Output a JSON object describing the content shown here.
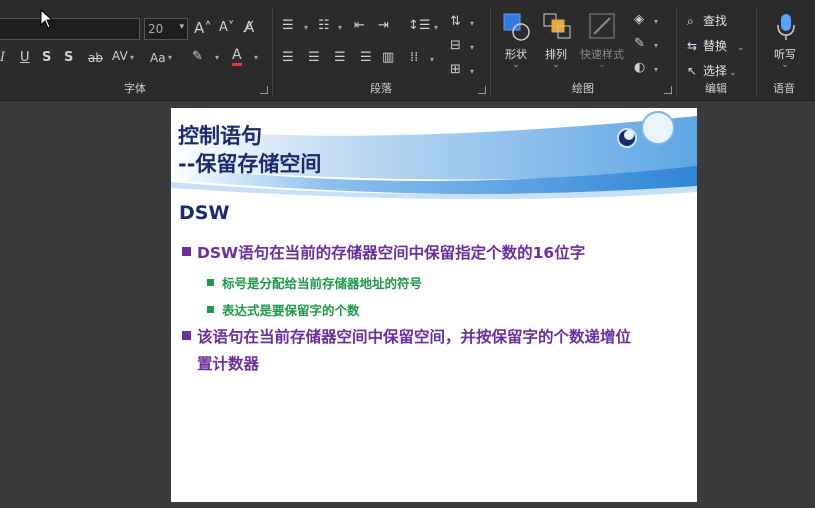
{
  "ribbon": {
    "font_group": {
      "label": "字体",
      "font_size": "20"
    },
    "paragraph_group": {
      "label": "段落"
    },
    "drawing_group": {
      "label": "绘图",
      "shape_label": "形状",
      "arrange_label": "排列",
      "quick_style_label": "快速样式"
    },
    "editing_group": {
      "label": "编辑",
      "find_label": "查找",
      "replace_label": "替换",
      "select_label": "选择"
    },
    "voice_group": {
      "label": "语音",
      "dictate_label": "听写"
    },
    "colors": {
      "accent_blue": "#5aa0ff",
      "font_color_bar": "#e03a3a"
    }
  },
  "slide": {
    "title_line1": "控制语句",
    "title_line2": "--保留存储空间",
    "subtitle": "DSW",
    "bullets": [
      {
        "level": 1,
        "text": "DSW语句在当前的存储器空间中保留指定个数的16位字"
      },
      {
        "level": 2,
        "text": "标号是分配给当前存储器地址的符号"
      },
      {
        "level": 2,
        "text": "表达式是要保留字的个数"
      },
      {
        "level": 1,
        "text_line1": "该语句在当前存储器空间中保留空间，并按保留字的个数递增位",
        "text_line2": "置计数器"
      }
    ],
    "colors": {
      "title": "#1a2a6e",
      "level1": "#6a2fa0",
      "level2": "#1f9a4a",
      "header_wave": "#3a8fd8"
    }
  }
}
